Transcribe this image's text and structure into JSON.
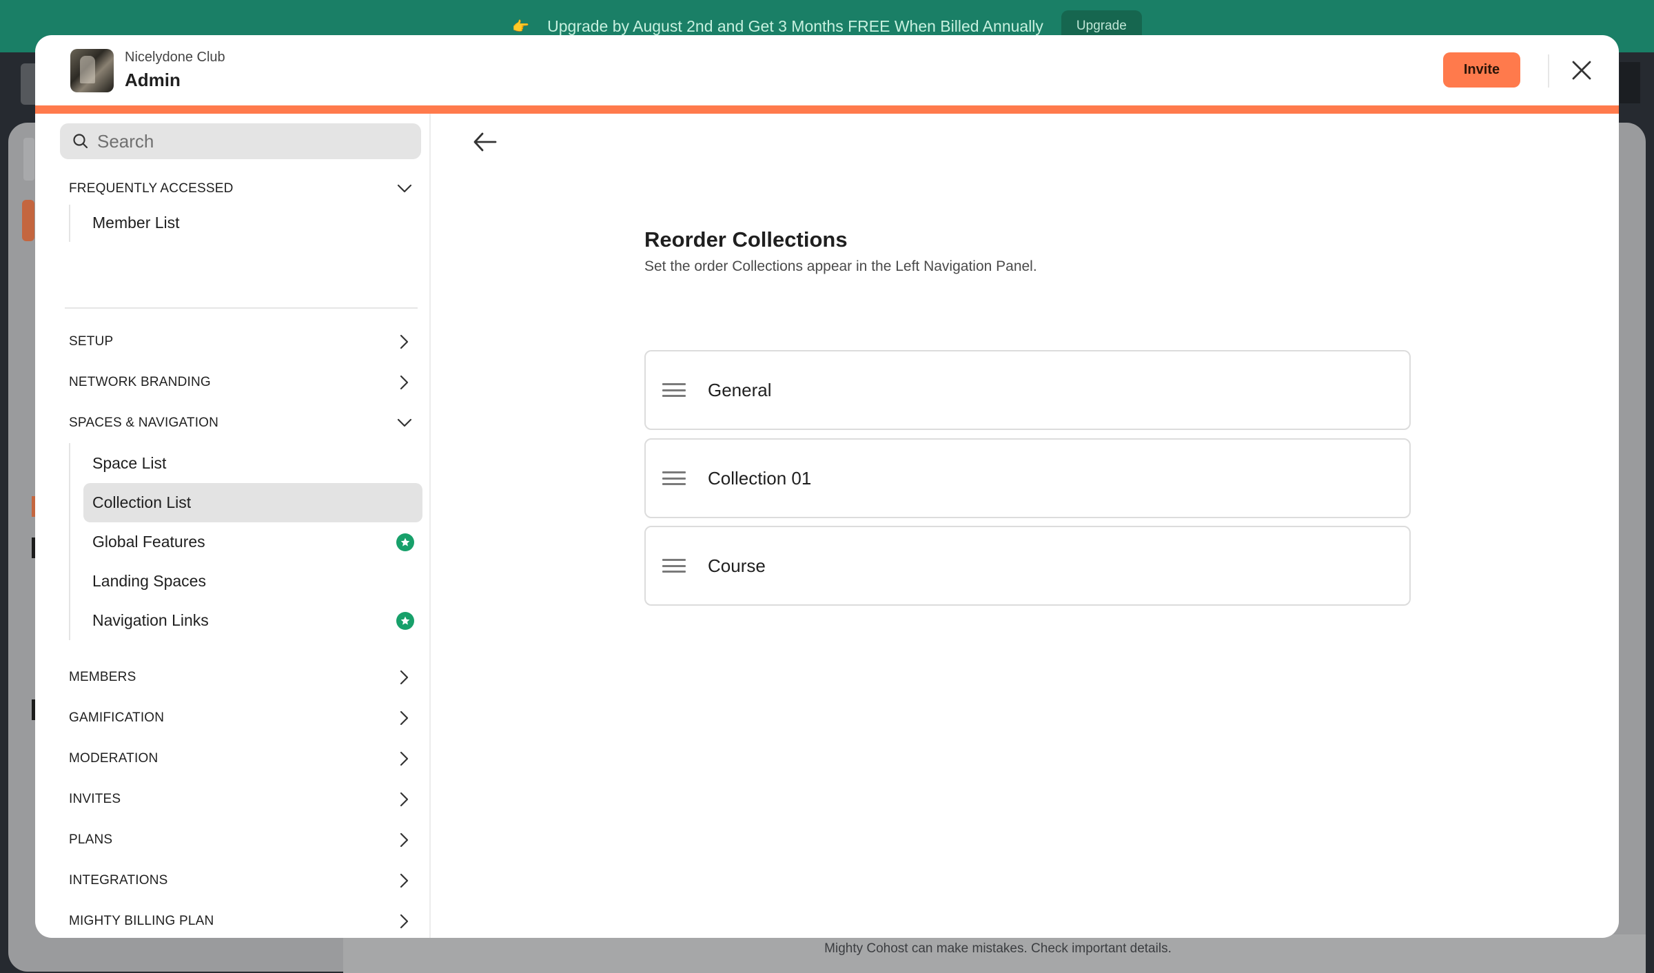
{
  "banner": {
    "emoji": "👉",
    "text": "Upgrade by August 2nd and Get 3 Months FREE When Billed Annually",
    "button_label": "Upgrade"
  },
  "background_footer_note": "Mighty Cohost can make mistakes. Check important details.",
  "header": {
    "club_name": "Nicelydone Club",
    "role": "Admin",
    "invite_label": "Invite"
  },
  "colors": {
    "accent": "#ff7a4c",
    "badge_green": "#17a06a",
    "banner_green": "#1a7f66"
  },
  "sidebar": {
    "search_placeholder": "Search",
    "frequently_accessed": {
      "label": "FREQUENTLY ACCESSED",
      "items": [
        {
          "label": "Member List"
        }
      ]
    },
    "sections": [
      {
        "label": "SETUP",
        "icon": "chevron-right-icon"
      },
      {
        "label": "NETWORK BRANDING",
        "icon": "chevron-right-icon"
      }
    ],
    "spaces_navigation": {
      "label": "SPACES & NAVIGATION",
      "items": [
        {
          "label": "Space List",
          "badge": false
        },
        {
          "label": "Collection List",
          "badge": false,
          "active": true
        },
        {
          "label": "Global Features",
          "badge": true
        },
        {
          "label": "Landing Spaces",
          "badge": false
        },
        {
          "label": "Navigation Links",
          "badge": true
        }
      ]
    },
    "more_sections": [
      {
        "label": "MEMBERS"
      },
      {
        "label": "GAMIFICATION"
      },
      {
        "label": "MODERATION"
      },
      {
        "label": "INVITES"
      },
      {
        "label": "PLANS"
      },
      {
        "label": "INTEGRATIONS"
      },
      {
        "label": "MIGHTY BILLING PLAN"
      }
    ]
  },
  "main": {
    "title": "Reorder Collections",
    "subtitle": "Set the order Collections appear in the Left Navigation Panel.",
    "collections": [
      {
        "name": "General"
      },
      {
        "name": "Collection 01"
      },
      {
        "name": "Course"
      }
    ]
  }
}
